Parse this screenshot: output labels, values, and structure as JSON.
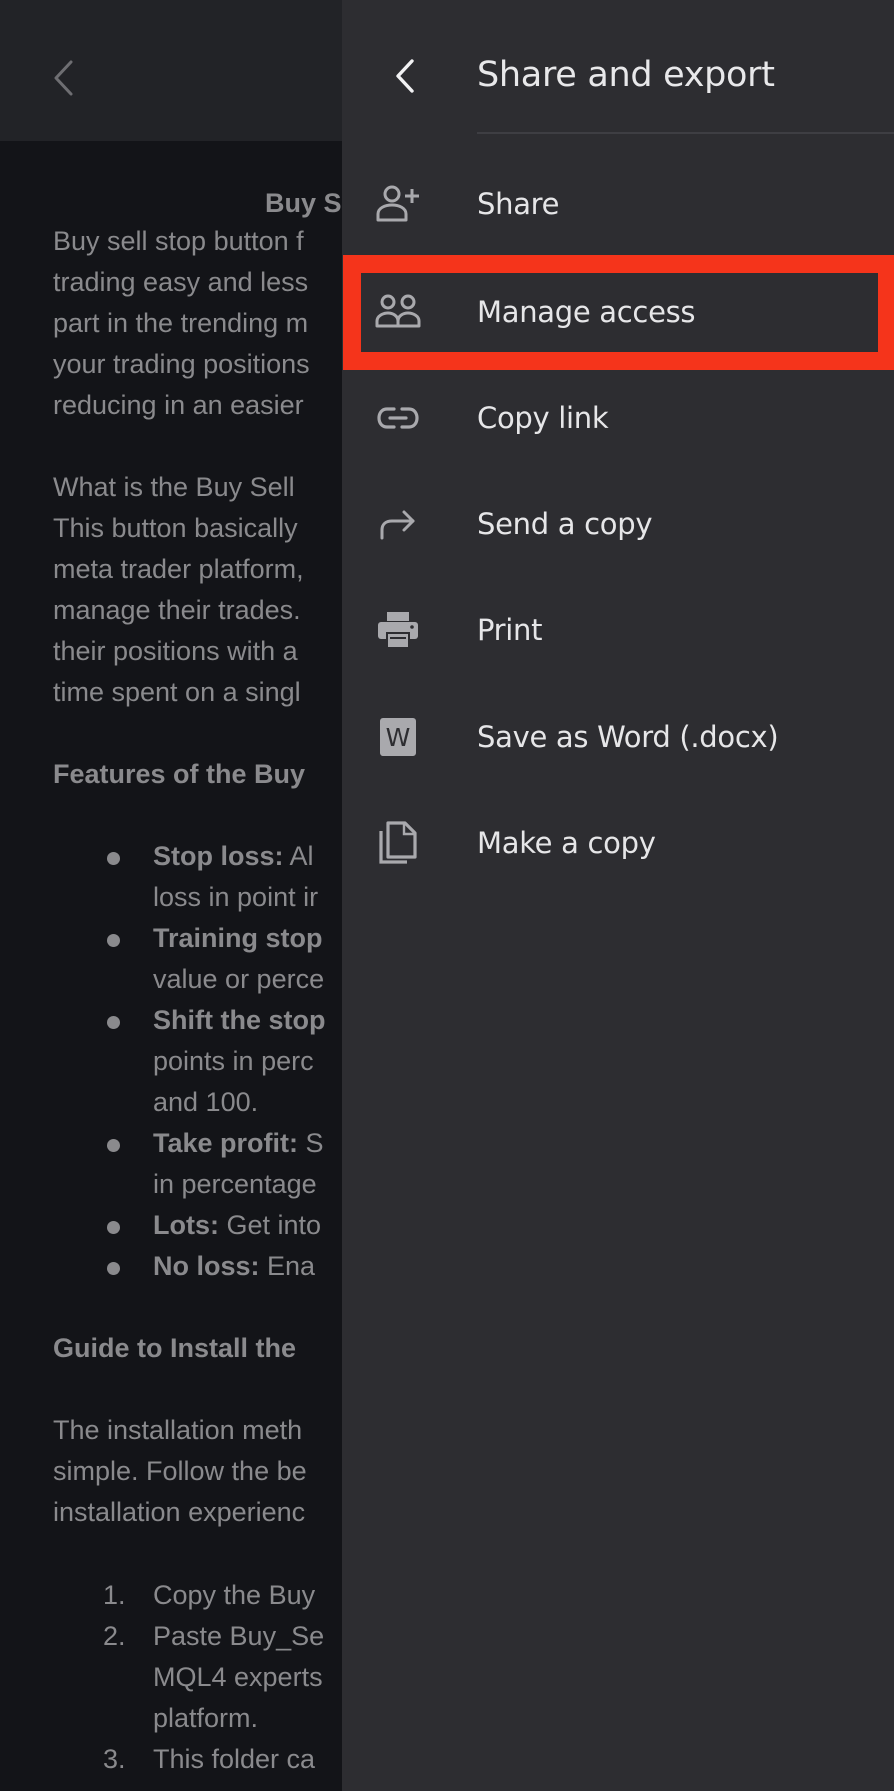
{
  "document": {
    "title": "Buy Sell",
    "paragraph1": [
      "Buy sell stop button f",
      "trading easy and less",
      "part in the trending m",
      "your trading positions",
      "reducing in an easier"
    ],
    "paragraph2": [
      "What is the Buy Sell",
      "This button basically",
      "meta trader platform,",
      "manage their trades.",
      "their positions with a",
      "time spent on a singl"
    ],
    "features_heading": "Features of the Buy",
    "features": [
      {
        "bold": "Stop loss:",
        "text": " Al",
        "cont": "loss in point ir"
      },
      {
        "bold": "Training stop",
        "text": "",
        "cont": "value or perce"
      },
      {
        "bold": "Shift the stop",
        "text": "",
        "cont": "points in perc",
        "cont2": "and 100."
      },
      {
        "bold": "Take profit:",
        "text": " S",
        "cont": "in percentage"
      },
      {
        "bold": "Lots:",
        "text": " Get into"
      },
      {
        "bold": "No loss:",
        "text": " Ena"
      }
    ],
    "guide_heading": "Guide to Install the",
    "paragraph3": [
      "The installation meth",
      "simple. Follow the be",
      "installation experienc"
    ],
    "steps": [
      {
        "num": "1.",
        "lines": [
          "Copy the Buy"
        ]
      },
      {
        "num": "2.",
        "lines": [
          "Paste Buy_Se",
          "MQL4 experts",
          "platform."
        ]
      },
      {
        "num": "3.",
        "lines": [
          "This folder ca"
        ]
      }
    ]
  },
  "panel": {
    "title": "Share and export",
    "items": [
      {
        "label": "Share",
        "icon": "person-add-icon"
      },
      {
        "label": "Manage access",
        "icon": "people-icon"
      },
      {
        "label": "Copy link",
        "icon": "link-icon"
      },
      {
        "label": "Send a copy",
        "icon": "forward-arrow-icon"
      },
      {
        "label": "Print",
        "icon": "printer-icon"
      },
      {
        "label": "Save as Word (.docx)",
        "icon": "word-icon",
        "glyph": "W"
      },
      {
        "label": "Make a copy",
        "icon": "copy-file-icon"
      }
    ],
    "highlighted_item": "Manage access",
    "highlight_color": "#f5341b"
  }
}
